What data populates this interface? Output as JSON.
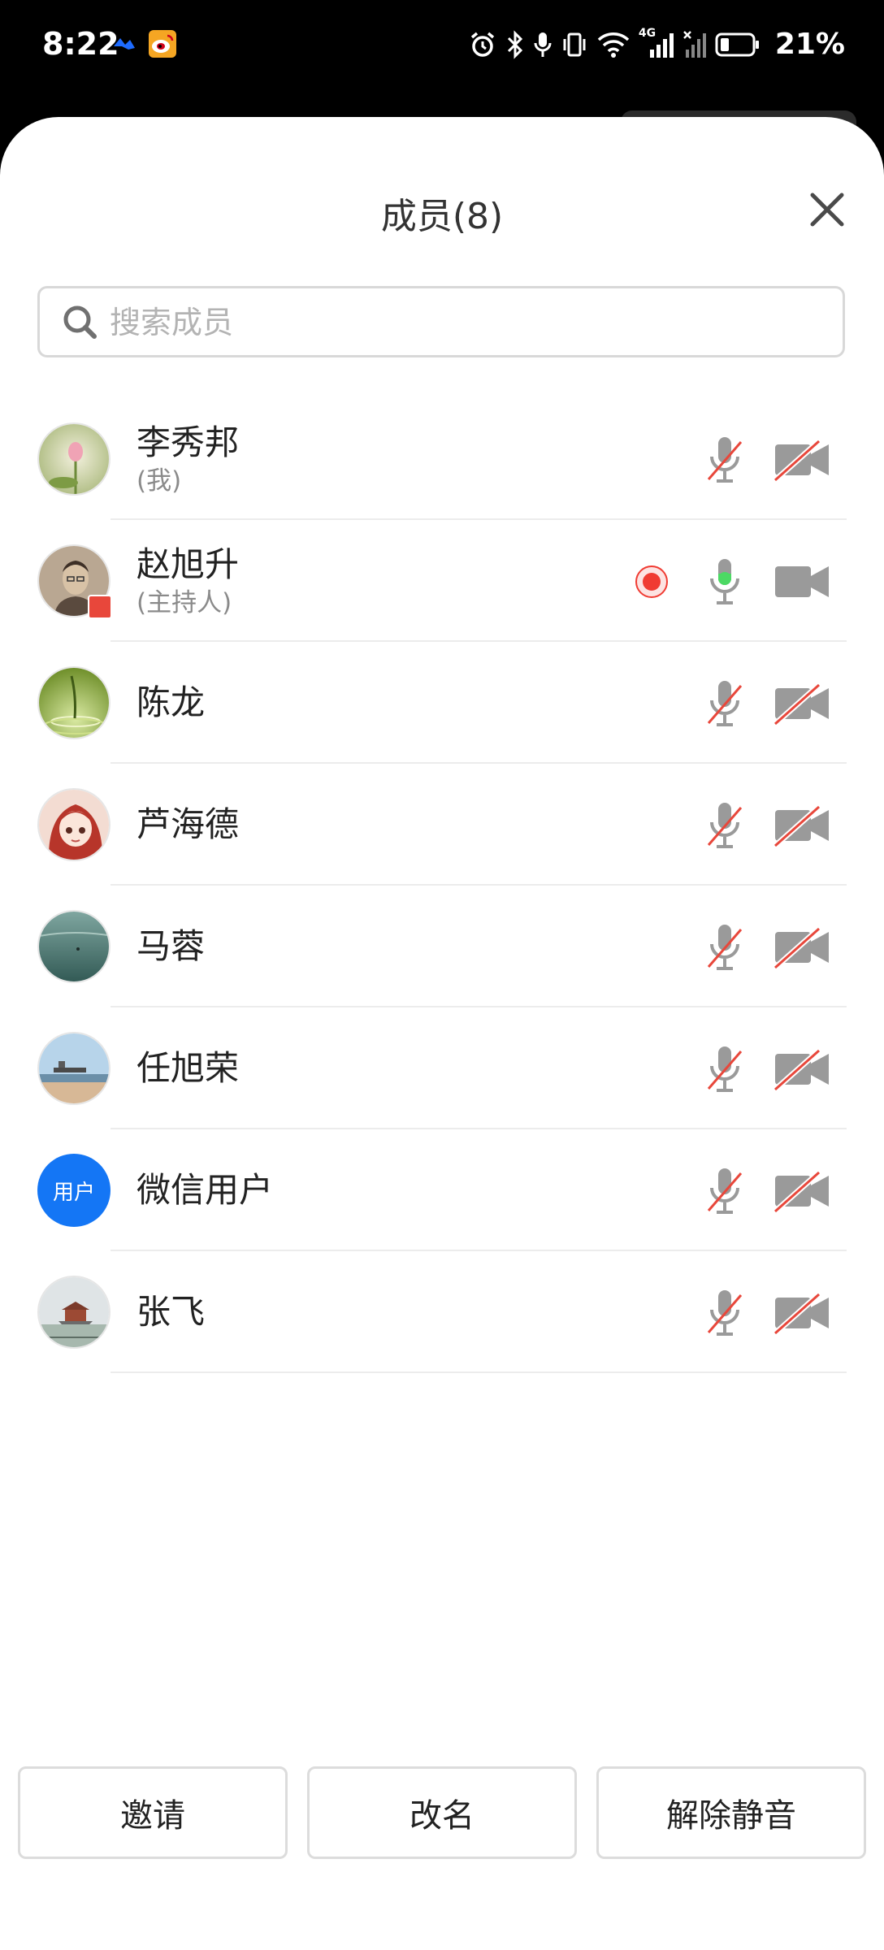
{
  "status_bar": {
    "time": "8:22",
    "battery_percent": "21%",
    "network_label": "4G",
    "icons": [
      "feishu-icon",
      "weibo-icon",
      "alarm-icon",
      "bluetooth-icon",
      "mic-icon",
      "vibrate-icon",
      "wifi-icon",
      "signal-icon",
      "signal-no-sim-icon",
      "battery-icon"
    ]
  },
  "panel": {
    "title": "成员(8)",
    "search_placeholder": "搜索成员"
  },
  "colors": {
    "accent": "#1476f5",
    "record_red": "#f03b32",
    "mic_active_green": "#4cd964",
    "icon_gray": "#9a9a9a",
    "muted_slash_red": "#e8473b"
  },
  "members": [
    {
      "name": "李秀邦",
      "role": "(我)",
      "avatar": "lotus-photo",
      "mic": "muted",
      "camera": "off",
      "recording": false
    },
    {
      "name": "赵旭升",
      "role": "(主持人)",
      "avatar": "portrait-sketch",
      "mic": "active",
      "camera": "on",
      "recording": true
    },
    {
      "name": "陈龙",
      "role": "",
      "avatar": "green-water-photo",
      "mic": "muted",
      "camera": "off",
      "recording": false
    },
    {
      "name": "芦海德",
      "role": "",
      "avatar": "anime-girl",
      "mic": "muted",
      "camera": "off",
      "recording": false
    },
    {
      "name": "马蓉",
      "role": "",
      "avatar": "teal-water-photo",
      "mic": "muted",
      "camera": "off",
      "recording": false
    },
    {
      "name": "任旭荣",
      "role": "",
      "avatar": "beach-pier-photo",
      "mic": "muted",
      "camera": "off",
      "recording": false
    },
    {
      "name": "微信用户",
      "role": "",
      "avatar": "text",
      "avatar_text": "用户",
      "mic": "muted",
      "camera": "off",
      "recording": false
    },
    {
      "name": "张飞",
      "role": "",
      "avatar": "palace-photo",
      "mic": "muted",
      "camera": "off",
      "recording": false
    }
  ],
  "actions": {
    "invite": "邀请",
    "rename": "改名",
    "unmute": "解除静音"
  }
}
